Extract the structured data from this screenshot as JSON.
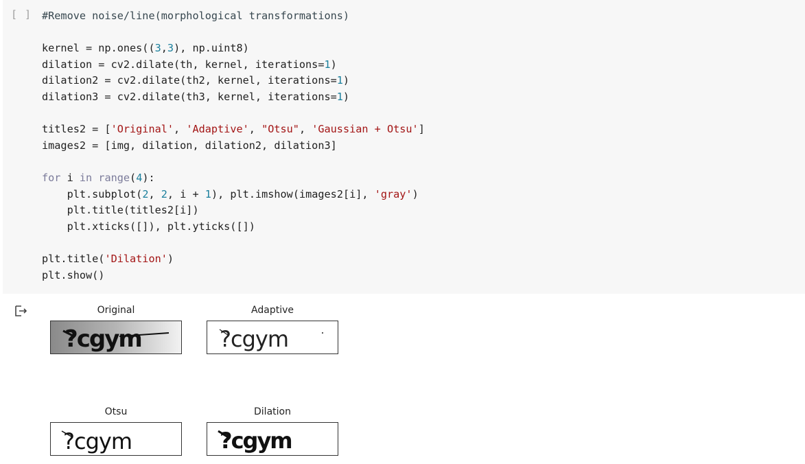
{
  "cell": {
    "run_indicator": "[ ]",
    "code_lines": [
      [
        {
          "t": "#Remove noise/line(morphological transformations)",
          "c": "com"
        }
      ],
      [],
      [
        {
          "t": "kernel = np.ones((",
          "c": ""
        },
        {
          "t": "3",
          "c": "num"
        },
        {
          "t": ",",
          "c": ""
        },
        {
          "t": "3",
          "c": "num"
        },
        {
          "t": "), np.uint8)",
          "c": ""
        }
      ],
      [
        {
          "t": "dilation = cv2.dilate(th, kernel, iterations=",
          "c": ""
        },
        {
          "t": "1",
          "c": "num"
        },
        {
          "t": ")",
          "c": ""
        }
      ],
      [
        {
          "t": "dilation2 = cv2.dilate(th2, kernel, iterations=",
          "c": ""
        },
        {
          "t": "1",
          "c": "num"
        },
        {
          "t": ")",
          "c": ""
        }
      ],
      [
        {
          "t": "dilation3 = cv2.dilate(th3, kernel, iterations=",
          "c": ""
        },
        {
          "t": "1",
          "c": "num"
        },
        {
          "t": ")",
          "c": ""
        }
      ],
      [],
      [
        {
          "t": "titles2 = [",
          "c": ""
        },
        {
          "t": "'Original'",
          "c": "str"
        },
        {
          "t": ", ",
          "c": ""
        },
        {
          "t": "'Adaptive'",
          "c": "str"
        },
        {
          "t": ", ",
          "c": ""
        },
        {
          "t": "\"Otsu\"",
          "c": "str"
        },
        {
          "t": ", ",
          "c": ""
        },
        {
          "t": "'Gaussian + Otsu'",
          "c": "str"
        },
        {
          "t": "]",
          "c": ""
        }
      ],
      [
        {
          "t": "images2 = [img, dilation, dilation2, dilation3]",
          "c": ""
        }
      ],
      [],
      [
        {
          "t": "for",
          "c": "kw"
        },
        {
          "t": " i ",
          "c": ""
        },
        {
          "t": "in",
          "c": "kw"
        },
        {
          "t": " ",
          "c": ""
        },
        {
          "t": "range",
          "c": "kw"
        },
        {
          "t": "(",
          "c": ""
        },
        {
          "t": "4",
          "c": "num"
        },
        {
          "t": "):",
          "c": ""
        }
      ],
      [
        {
          "t": "    plt.subplot(",
          "c": ""
        },
        {
          "t": "2",
          "c": "num"
        },
        {
          "t": ", ",
          "c": ""
        },
        {
          "t": "2",
          "c": "num"
        },
        {
          "t": ", i + ",
          "c": ""
        },
        {
          "t": "1",
          "c": "num"
        },
        {
          "t": "), plt.imshow(images2[i], ",
          "c": ""
        },
        {
          "t": "'gray'",
          "c": "str"
        },
        {
          "t": ")",
          "c": ""
        }
      ],
      [
        {
          "t": "    plt.title(titles2[i])",
          "c": ""
        }
      ],
      [
        {
          "t": "    plt.xticks([]), plt.yticks([])",
          "c": ""
        }
      ],
      [],
      [
        {
          "t": "plt.title(",
          "c": ""
        },
        {
          "t": "'Dilation'",
          "c": "str"
        },
        {
          "t": ")",
          "c": ""
        }
      ],
      [
        {
          "t": "plt.show()",
          "c": ""
        }
      ]
    ]
  },
  "output": {
    "icon": "output-arrow-icon",
    "subplots": [
      {
        "title": "Original",
        "image": "captcha-original",
        "captcha_text": "?cgym"
      },
      {
        "title": "Adaptive",
        "image": "captcha-adaptive",
        "captcha_text": "?cgym"
      },
      {
        "title": "Otsu",
        "image": "captcha-otsu",
        "captcha_text": "?cgym"
      },
      {
        "title": "Dilation",
        "image": "captcha-dilation",
        "captcha_text": "?cgym"
      }
    ]
  }
}
